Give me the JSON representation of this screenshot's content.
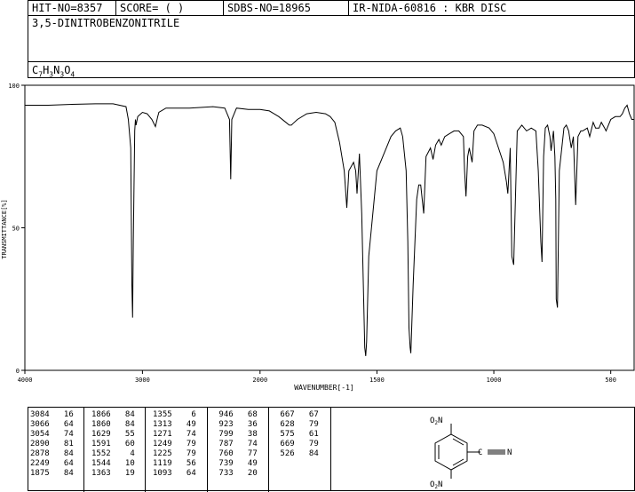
{
  "header": {
    "hit_no": "HIT-NO=8357",
    "score": "SCORE=  (   )",
    "sdbs_no": "SDBS-NO=18965",
    "ir_info": "IR-NIDA-60816 : KBR DISC"
  },
  "compound_name": "3,5-DINITROBENZONITRILE",
  "formula": {
    "parts": [
      "C",
      "7",
      "H",
      "3",
      "N",
      "3",
      "O",
      "4"
    ]
  },
  "chart_data": {
    "type": "line",
    "xlabel": "WAVENUMBER[-1]",
    "ylabel": "TRANSMITTANCE[%]",
    "xlim": [
      4000,
      400
    ],
    "ylim": [
      0,
      100
    ],
    "x_ticks": [
      4000,
      3000,
      2000,
      1500,
      1000,
      500
    ],
    "y_ticks": [
      0,
      50,
      100
    ],
    "series": [
      {
        "x": [
          4000,
          3800,
          3600,
          3400,
          3250,
          3140,
          3120,
          3100,
          3090,
          3084,
          3078,
          3066,
          3060,
          3054,
          3040,
          3000,
          2960,
          2920,
          2890,
          2870,
          2860,
          2800,
          2700,
          2600,
          2400,
          2300,
          2260,
          2249,
          2240,
          2200,
          2100,
          2000,
          1960,
          1920,
          1890,
          1875,
          1866,
          1860,
          1840,
          1800,
          1760,
          1720,
          1700,
          1680,
          1660,
          1640,
          1629,
          1620,
          1600,
          1591,
          1585,
          1575,
          1565,
          1552,
          1548,
          1544,
          1535,
          1500,
          1460,
          1440,
          1420,
          1400,
          1390,
          1375,
          1368,
          1363,
          1358,
          1355,
          1345,
          1330,
          1321,
          1313,
          1300,
          1290,
          1271,
          1260,
          1249,
          1235,
          1225,
          1210,
          1190,
          1170,
          1150,
          1130,
          1125,
          1119,
          1112,
          1105,
          1093,
          1085,
          1070,
          1050,
          1020,
          1000,
          980,
          960,
          946,
          940,
          930,
          923,
          915,
          900,
          880,
          860,
          840,
          820,
          810,
          799,
          794,
          787,
          780,
          770,
          760,
          755,
          745,
          739,
          735,
          733,
          728,
          720,
          700,
          690,
          680,
          669,
          660,
          650,
          640,
          628,
          620,
          600,
          590,
          575,
          565,
          550,
          540,
          526,
          520,
          500,
          480,
          460,
          450,
          440,
          430,
          420,
          410,
          400
        ],
        "y": [
          93,
          93,
          93.3,
          93.5,
          93.5,
          92.5,
          88,
          78,
          30,
          18.5,
          45,
          84,
          88,
          86,
          89,
          90.5,
          90,
          88,
          85.5,
          89,
          90.5,
          92,
          92,
          92,
          92.5,
          92,
          88,
          67,
          88,
          92,
          91.5,
          91.5,
          91,
          89,
          87,
          86,
          86,
          86.5,
          88,
          90,
          90.5,
          90,
          89,
          87,
          80,
          70,
          57,
          70,
          73,
          70,
          62,
          76,
          55,
          8,
          5,
          10,
          40,
          70,
          78,
          82,
          84,
          85,
          82,
          70,
          45,
          15,
          8,
          6,
          30,
          60,
          65,
          65,
          55,
          75,
          78,
          74,
          79,
          81,
          79,
          82,
          83,
          84,
          84,
          82,
          70,
          61,
          75,
          78,
          73,
          84,
          86,
          86,
          85,
          83,
          78,
          73,
          66,
          62,
          78,
          40,
          37,
          84,
          86,
          84,
          85,
          84,
          70,
          45,
          38,
          75,
          85,
          86,
          82,
          77,
          84,
          75,
          60,
          25,
          22,
          70,
          85,
          86,
          84,
          78,
          82,
          58,
          82,
          84,
          84,
          85,
          82,
          87,
          85,
          85,
          87,
          85,
          84,
          88,
          89,
          89,
          90,
          92,
          93,
          90,
          88,
          88
        ]
      }
    ]
  },
  "peak_table": {
    "columns": [
      [
        [
          "3084",
          "16"
        ],
        [
          "3066",
          "64"
        ],
        [
          "3054",
          "74"
        ],
        [
          "2890",
          "81"
        ],
        [
          "2878",
          "84"
        ],
        [
          "2249",
          "64"
        ],
        [
          "1875",
          "84"
        ]
      ],
      [
        [
          "1866",
          "84"
        ],
        [
          "1860",
          "84"
        ],
        [
          "1629",
          "55"
        ],
        [
          "1591",
          "60"
        ],
        [
          "1552",
          "4"
        ],
        [
          "1544",
          "10"
        ],
        [
          "1363",
          "19"
        ]
      ],
      [
        [
          "1355",
          "6"
        ],
        [
          "1313",
          "49"
        ],
        [
          "1271",
          "74"
        ],
        [
          "1249",
          "79"
        ],
        [
          "1225",
          "79"
        ],
        [
          "1119",
          "56"
        ],
        [
          "1093",
          "64"
        ]
      ],
      [
        [
          "946",
          "68"
        ],
        [
          "923",
          "36"
        ],
        [
          "799",
          "38"
        ],
        [
          "787",
          "74"
        ],
        [
          "760",
          "77"
        ],
        [
          "739",
          "49"
        ],
        [
          "733",
          "20"
        ]
      ],
      [
        [
          "667",
          "67"
        ],
        [
          "628",
          "79"
        ],
        [
          "575",
          "61"
        ],
        [
          "669",
          "79"
        ],
        [
          "526",
          "84"
        ]
      ]
    ]
  },
  "structure": {
    "top_group": "O2N",
    "bottom_group": "O2N",
    "nitrile_atom": "N",
    "subscript": "2",
    "O": "O",
    "N": "N"
  }
}
